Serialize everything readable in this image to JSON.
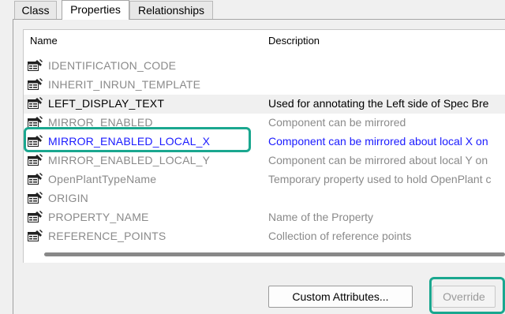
{
  "tabs": [
    {
      "label": "Class"
    },
    {
      "label": "Properties"
    },
    {
      "label": "Relationships"
    }
  ],
  "columns": {
    "name": "Name",
    "description": "Description"
  },
  "rows": [
    {
      "name": "IDENTIFICATION_CODE",
      "description": "",
      "style": "grey"
    },
    {
      "name": "INHERIT_INRUN_TEMPLATE",
      "description": "",
      "style": "grey"
    },
    {
      "name": "LEFT_DISPLAY_TEXT",
      "description": "Used for annotating the Left side of Spec Bre",
      "style": "black"
    },
    {
      "name": "MIRROR_ENABLED",
      "description": "Component can be mirrored",
      "style": "grey"
    },
    {
      "name": "MIRROR_ENABLED_LOCAL_X",
      "description": "Component can be mirrored about local X on",
      "style": "blue"
    },
    {
      "name": "MIRROR_ENABLED_LOCAL_Y",
      "description": "Component can be mirrored about local Y on",
      "style": "grey"
    },
    {
      "name": "OpenPlantTypeName",
      "description": "Temporary property used to hold OpenPlant c",
      "style": "grey"
    },
    {
      "name": "ORIGIN",
      "description": "",
      "style": "grey"
    },
    {
      "name": "PROPERTY_NAME",
      "description": "Name of the Property",
      "style": "grey"
    },
    {
      "name": "REFERENCE_POINTS",
      "description": "Collection of reference points",
      "style": "grey"
    }
  ],
  "icon": "property-icon",
  "buttons": {
    "custom_attributes": "Custom Attributes...",
    "override": "Override"
  },
  "colors": {
    "highlight": "#1aa78f",
    "selected_text": "#1a1aff",
    "grey_text": "#8a8a8a"
  }
}
